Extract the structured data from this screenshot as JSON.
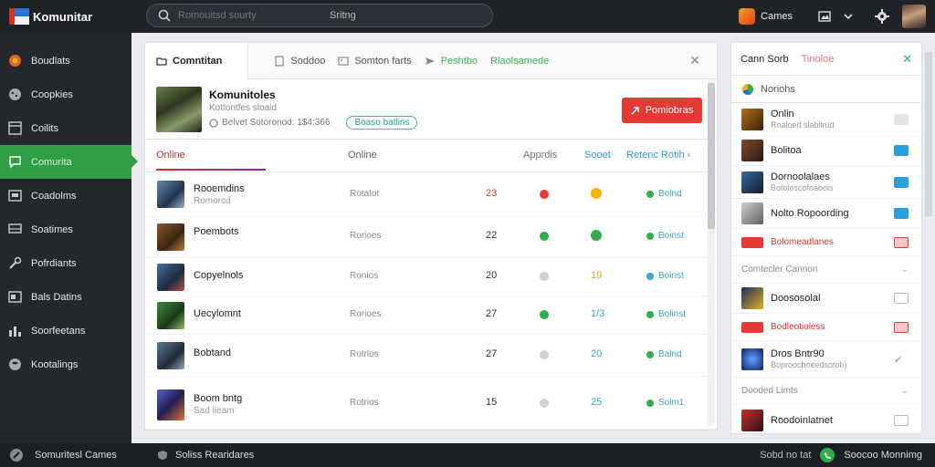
{
  "app": {
    "title": "Komunitar"
  },
  "search": {
    "placeholder": "Romouitsd sourty",
    "filter": "Sritng"
  },
  "topbar": {
    "games_label": "Cames"
  },
  "sidebar": {
    "items": [
      {
        "label": "Boudlats",
        "icon": "globe-icon"
      },
      {
        "label": "Coopkies",
        "icon": "cookie-icon"
      },
      {
        "label": "Coilits",
        "icon": "layout-icon"
      },
      {
        "label": "Comurita",
        "icon": "chat-icon",
        "active": true
      },
      {
        "label": "Coadolms",
        "icon": "window-icon"
      },
      {
        "label": "Soatimes",
        "icon": "monitor-icon"
      },
      {
        "label": "Pofrdiants",
        "icon": "wrench-icon"
      },
      {
        "label": "Bals Datins",
        "icon": "window-icon"
      },
      {
        "label": "Soorfeetans",
        "icon": "bar-chart-icon"
      },
      {
        "label": "Kootalings",
        "icon": "globe-icon"
      }
    ]
  },
  "tabs": [
    {
      "label": "Comntitan",
      "icon": "folder-icon"
    },
    {
      "label": "Soddoo",
      "icon": "doc-icon"
    },
    {
      "label": "Somton farts",
      "icon": "image-icon"
    },
    {
      "label": "Peshtbo",
      "icon": "send-icon",
      "color": "#3fae52"
    },
    {
      "label": "Rlaolsamede",
      "color": "#3fae52"
    }
  ],
  "profile": {
    "name": "Komunitoles",
    "subtitle": "Kottontfes sloaid",
    "meta": "Belvet Sotoronod: 1$4:366",
    "badge": "Boaso batlins",
    "button": "Pomiobras"
  },
  "columns": {
    "name": "Online",
    "status": "Online",
    "approx": "Apprdis",
    "sort": "Sooet",
    "ret": "Retenc Rotih"
  },
  "rows": [
    {
      "name": "Rooemdins",
      "sub": "Romorcd",
      "status": "Rotator",
      "num": "23",
      "num_color": "#c0392b",
      "dot": "#e53935",
      "val": "",
      "val_color": "#f4b400",
      "val_icon": "badge",
      "action": "Bolnd"
    },
    {
      "name": "Poembots",
      "sub": "",
      "status": "Rorioes",
      "num": "22",
      "num_color": "#555",
      "dot": "#2fae4b",
      "val": "",
      "val_color": "#2fae4b",
      "val_icon": "check",
      "action": "Boinst"
    },
    {
      "name": "Copyelnols",
      "sub": "",
      "status": "Ronios",
      "num": "20",
      "num_color": "#555",
      "dot": "#cfd2d6",
      "val": "19",
      "val_color": "#e6a700",
      "action": "Boinst"
    },
    {
      "name": "Uecylomnt",
      "sub": "",
      "status": "Rorioes",
      "num": "27",
      "num_color": "#555",
      "dot": "#2fae4b",
      "val": "1/3",
      "val_color": "#3aa6c8",
      "action": "Bolinst"
    },
    {
      "name": "Bobtand",
      "sub": "",
      "status": "Rotrlos",
      "num": "27",
      "num_color": "#555",
      "dot": "#cfd2d6",
      "val": "20",
      "val_color": "#3aa6c8",
      "action": "Balnd"
    },
    {
      "name": "Boom bntg",
      "sub": "Sad lieam",
      "status": "Rotrios",
      "num": "15",
      "num_color": "#555",
      "dot": "#cfd2d6",
      "val": "25",
      "val_color": "#3aa6c8",
      "action": "Solm1"
    }
  ],
  "right_panel": {
    "tab1": "Cann Sorb",
    "tab2": "Tinoloe",
    "subheader": "Noriohs",
    "items": [
      {
        "name": "Onlin",
        "sub": "Roaloed slabilrud"
      },
      {
        "name": "Bolitoa",
        "sub": ""
      },
      {
        "name": "Dornoolalaes",
        "sub": "Botoioscofoabols"
      },
      {
        "name": "Nolto Ropoording",
        "sub": ""
      }
    ],
    "red_row_1": "Bolomeadlanes",
    "section1": "Comtecler Cannon",
    "items2": [
      {
        "name": "Doososolal",
        "sub": ""
      }
    ],
    "red_row_2": "Bodleotioless",
    "items3": [
      {
        "name": "Dros Bntr90",
        "sub": "Boproocboeedsotob)"
      }
    ],
    "section2": "Dooded Limts",
    "items4": [
      {
        "name": "Roodoinlatnet",
        "sub": ""
      }
    ]
  },
  "bottombar": {
    "left": "Somuritesl Cames",
    "mid": "Soliss Rearidares",
    "right1": "Sobd no tat",
    "right2": "Soocoo Monnimg"
  }
}
